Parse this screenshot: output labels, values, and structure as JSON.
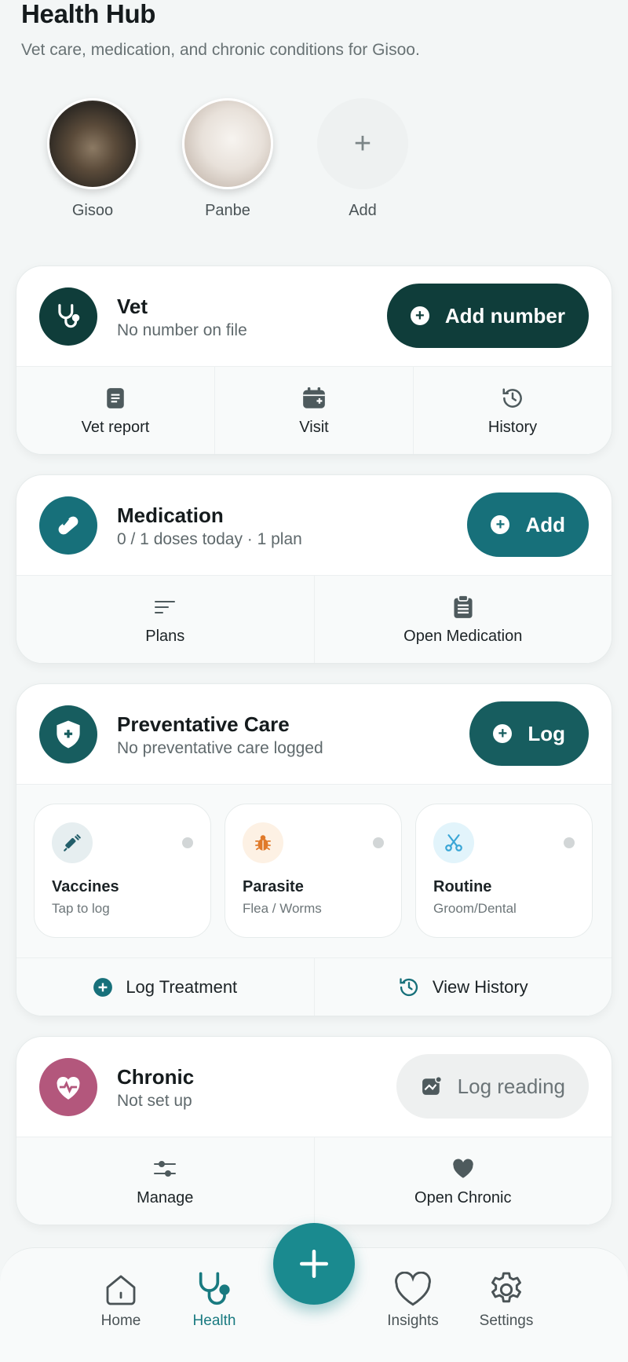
{
  "header": {
    "title": "Health Hub",
    "subtitle": "Vet care, medication, and chronic conditions for Gisoo."
  },
  "pets": [
    {
      "name": "Gisoo"
    },
    {
      "name": "Panbe"
    },
    {
      "name": "Add"
    }
  ],
  "vet": {
    "title": "Vet",
    "subtitle": "No number on file",
    "action_label": "Add number",
    "links": [
      "Vet report",
      "Visit",
      "History"
    ]
  },
  "medication": {
    "title": "Medication",
    "subtitle": "0 / 1 doses today · 1 plan",
    "action_label": "Add",
    "links": [
      "Plans",
      "Open Medication"
    ]
  },
  "preventative": {
    "title": "Preventative Care",
    "subtitle": "No preventative care logged",
    "action_label": "Log",
    "tiles": [
      {
        "name": "Vaccines",
        "sub": "Tap to log"
      },
      {
        "name": "Parasite",
        "sub": "Flea / Worms"
      },
      {
        "name": "Routine",
        "sub": "Groom/Dental"
      }
    ],
    "actions": [
      "Log Treatment",
      "View History"
    ]
  },
  "chronic": {
    "title": "Chronic",
    "subtitle": "Not set up",
    "action_label": "Log reading",
    "links": [
      "Manage",
      "Open Chronic"
    ]
  },
  "nav": {
    "items": [
      "Home",
      "Health",
      "Insights",
      "Settings"
    ],
    "active": "Health"
  },
  "colors": {
    "vet_dark": "#0f3d3a",
    "teal": "#17707a",
    "chronic_pink": "#b3577c",
    "fab": "#1a8a8f"
  }
}
